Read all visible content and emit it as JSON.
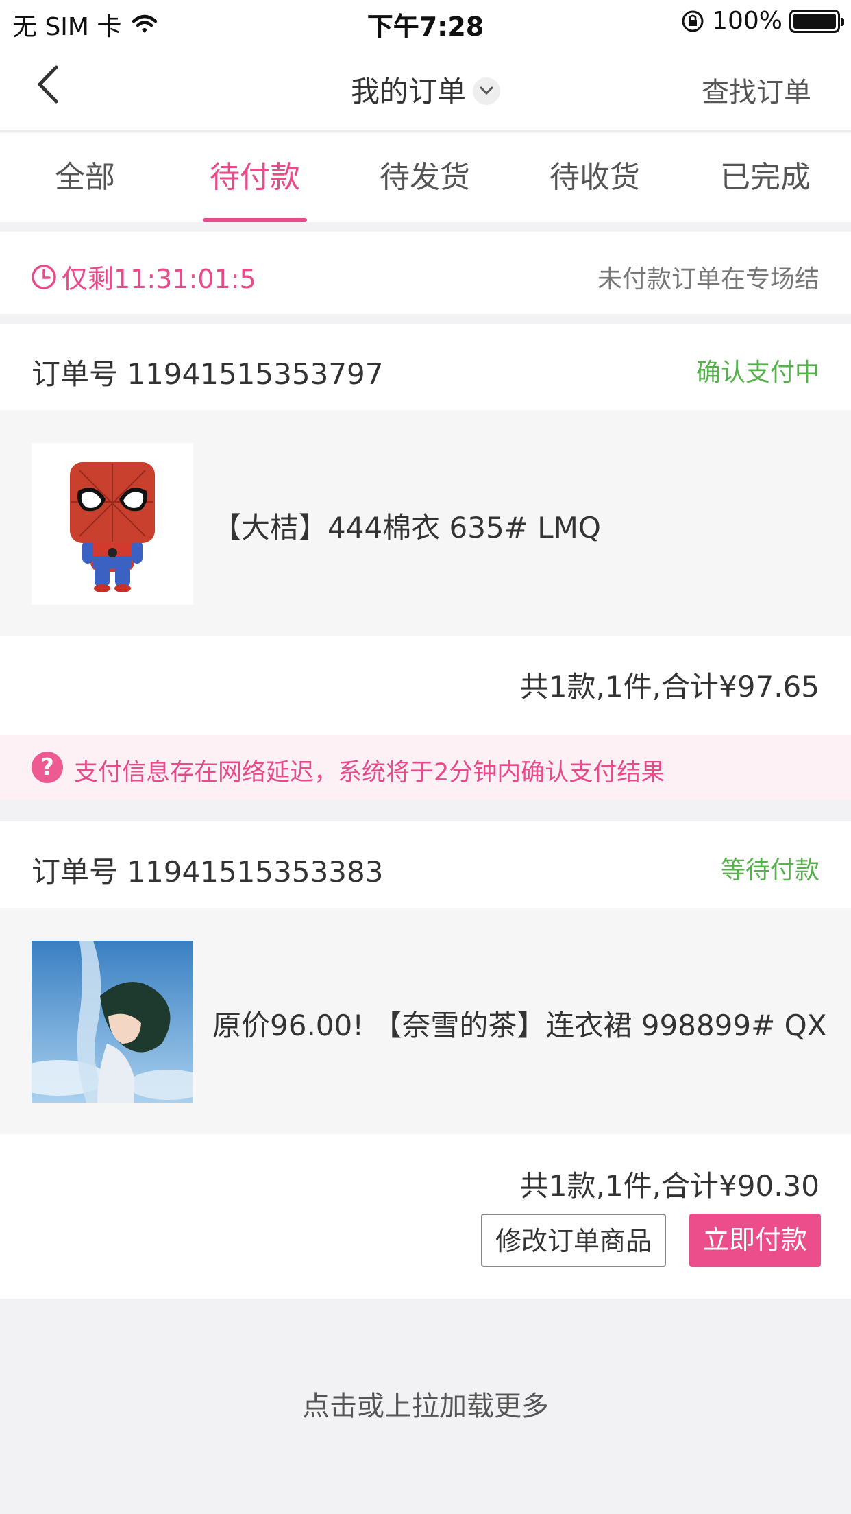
{
  "status_bar": {
    "carrier": "无 SIM 卡",
    "time": "下午7:28",
    "battery": "100%"
  },
  "nav": {
    "title": "我的订单",
    "right_action": "查找订单"
  },
  "tabs": [
    {
      "label": "全部"
    },
    {
      "label": "待付款"
    },
    {
      "label": "待发货"
    },
    {
      "label": "待收货"
    },
    {
      "label": "已完成"
    }
  ],
  "active_tab": "待付款",
  "countdown": {
    "text": "仅剩11:31:01:5",
    "right_text": "未付款订单在专场结"
  },
  "orders": [
    {
      "order_no": "订单号 11941515353797",
      "status": "确认支付中",
      "item_name": "【大桔】444棉衣 635# LMQ",
      "total": "共1款,1件,合计¥97.65",
      "notice": "支付信息存在网络延迟，系统将于2分钟内确认支付结果"
    },
    {
      "order_no": "订单号 11941515353383",
      "status": "等待付款",
      "item_name": "原价96.00! 【奈雪的茶】连衣裙  998899#  QX",
      "total": "共1款,1件,合计¥90.30",
      "buttons": {
        "modify": "修改订单商品",
        "pay": "立即付款"
      }
    }
  ],
  "load_more": "点击或上拉加载更多",
  "colors": {
    "accent": "#e94b8a",
    "status_green": "#55b14a"
  }
}
